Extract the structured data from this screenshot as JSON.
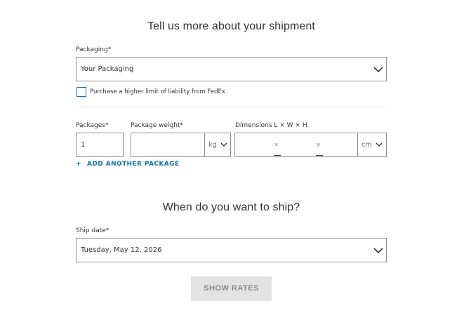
{
  "shipment": {
    "heading": "Tell us more about your shipment",
    "packaging_label": "Packaging",
    "packaging_value": "Your Packaging",
    "liability_label": "Purchase a higher limit of liability from FedEx",
    "packages_label": "Packages",
    "packages_value": "1",
    "weight_label": "Package weight",
    "weight_value": "",
    "weight_unit": "kg",
    "dimensions_label": "Dimensions L × W × H",
    "dim_separator": "×",
    "dimension_unit": "cm",
    "add_package_label": "ADD ANOTHER PACKAGE",
    "add_package_icon": "+"
  },
  "ship": {
    "heading": "When do you want to ship?",
    "date_label": "Ship date",
    "date_value": "Tuesday, May 12, 2026"
  },
  "required_marker": "*",
  "actions": {
    "show_rates_label": "SHOW RATES"
  },
  "colors": {
    "accent": "#0e6fa6",
    "border": "#8e8e8e",
    "button_disabled_bg": "#e3e3e3",
    "button_disabled_text": "#8a8a8a"
  }
}
